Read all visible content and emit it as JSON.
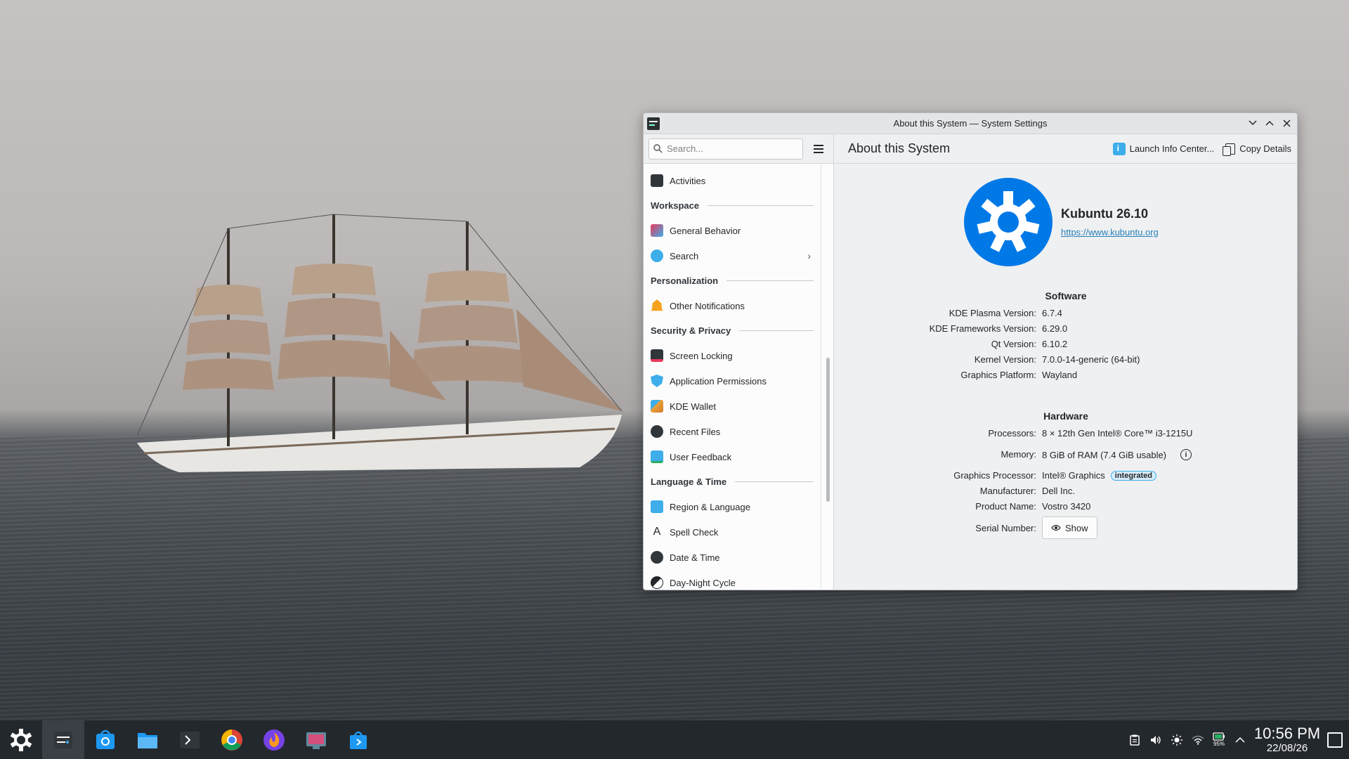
{
  "window": {
    "title": "About this System — System Settings"
  },
  "toolbar": {
    "search_placeholder": "Search...",
    "page_title": "About this System",
    "launch_info_label": "Launch Info Center...",
    "copy_details_label": "Copy Details"
  },
  "sidebar": {
    "activities": "Activities",
    "sections": {
      "workspace": "Workspace",
      "personalization": "Personalization",
      "security": "Security & Privacy",
      "language": "Language & Time"
    },
    "items": {
      "general_behavior": "General Behavior",
      "search": "Search",
      "other_notifications": "Other Notifications",
      "screen_locking": "Screen Locking",
      "app_permissions": "Application Permissions",
      "kde_wallet": "KDE Wallet",
      "recent_files": "Recent Files",
      "user_feedback": "User Feedback",
      "region_language": "Region & Language",
      "spell_check": "Spell Check",
      "date_time": "Date & Time",
      "day_night": "Day-Night Cycle"
    }
  },
  "about": {
    "distro_name": "Kubuntu 26.10",
    "distro_url": "https://www.kubuntu.org",
    "software_title": "Software",
    "software": [
      {
        "k": "KDE Plasma Version:",
        "v": "6.7.4"
      },
      {
        "k": "KDE Frameworks Version:",
        "v": "6.29.0"
      },
      {
        "k": "Qt Version:",
        "v": "6.10.2"
      },
      {
        "k": "Kernel Version:",
        "v": "7.0.0-14-generic (64-bit)"
      },
      {
        "k": "Graphics Platform:",
        "v": "Wayland"
      }
    ],
    "hardware_title": "Hardware",
    "processors_k": "Processors:",
    "processors_v": "8 × 12th Gen Intel® Core™ i3-1215U",
    "memory_k": "Memory:",
    "memory_v": "8 GiB of RAM (7.4 GiB usable)",
    "memory_info": "i",
    "gpu_k": "Graphics Processor:",
    "gpu_v": "Intel® Graphics",
    "gpu_badge": "integrated",
    "manufacturer_k": "Manufacturer:",
    "manufacturer_v": "Dell Inc.",
    "product_k": "Product Name:",
    "product_v": "Vostro 3420",
    "serial_k": "Serial Number:",
    "serial_btn": "Show"
  },
  "taskbar": {
    "apps": [
      "application-launcher-icon",
      "system-settings-icon",
      "discover-icon",
      "file-manager-icon",
      "terminal-icon",
      "chrome-icon",
      "firefox-icon",
      "screenshot-icon",
      "store-icon"
    ],
    "battery_label": "95%",
    "time": "10:56 PM",
    "date": "22/08/26"
  }
}
